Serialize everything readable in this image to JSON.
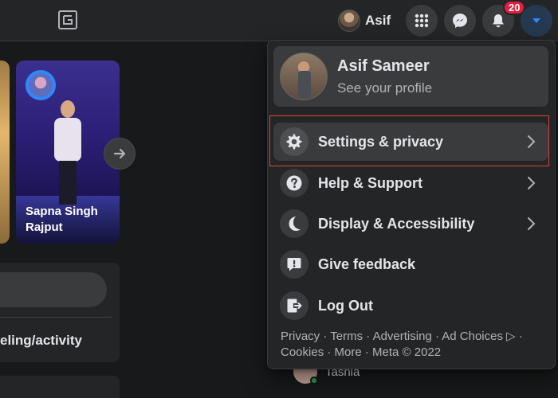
{
  "topbar": {
    "profile_name": "Asif",
    "notification_count": "20"
  },
  "feed": {
    "story_name": "Sapna Singh Rajput",
    "action_text": "eling/activity",
    "contact_name": "Tasnia"
  },
  "dropdown": {
    "profile": {
      "name": "Asif Sameer",
      "subtitle": "See your profile"
    },
    "items": [
      {
        "label": "Settings & privacy",
        "icon": "gear-icon",
        "has_chevron": true
      },
      {
        "label": "Help & Support",
        "icon": "question-icon",
        "has_chevron": true
      },
      {
        "label": "Display & Accessibility",
        "icon": "moon-icon",
        "has_chevron": true
      },
      {
        "label": "Give feedback",
        "icon": "feedback-icon",
        "has_chevron": false
      },
      {
        "label": "Log Out",
        "icon": "logout-icon",
        "has_chevron": false
      }
    ],
    "footer": {
      "line1": "Privacy · Terms · Advertising · Ad Choices ▷ ·",
      "line2": "Cookies · More · Meta © 2022"
    }
  },
  "colors": {
    "background": "#18191a",
    "surface": "#242526",
    "hover": "#3a3b3c",
    "accent": "#2d88ff",
    "badge": "#e41e3f",
    "highlight_border": "#e0453a"
  }
}
